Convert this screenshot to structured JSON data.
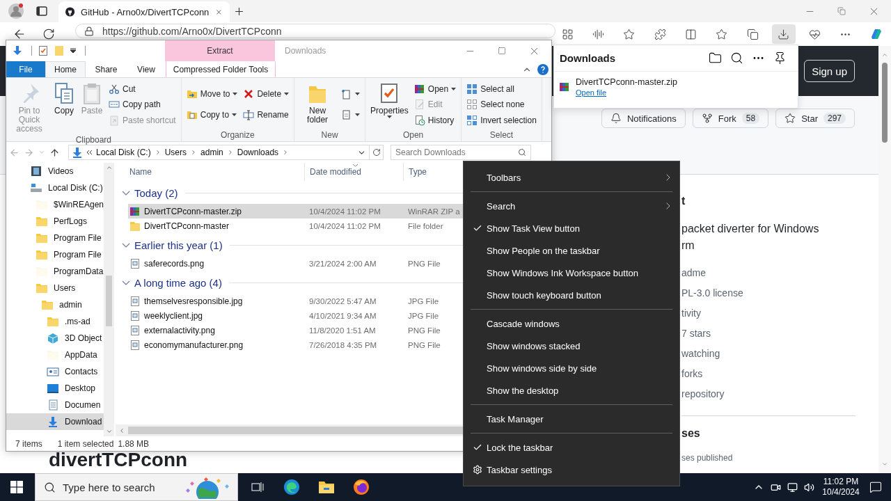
{
  "browser": {
    "tab": {
      "title": "GitHub - Arno0x/DivertTCPconn",
      "selected": true
    },
    "address": "https://github.com/Arno0x/DivertTCPconn",
    "page": {
      "header_button": "Sign up",
      "repo_actions": [
        {
          "label": "Notifications"
        },
        {
          "label": "Fork",
          "count": "58"
        },
        {
          "label": "Star",
          "count": "297"
        }
      ],
      "repo_title": "divertTCPconn",
      "about": {
        "heading": "t",
        "description": [
          "packet diverter for Windows",
          "rm"
        ],
        "links": [
          "adme",
          "PL-3.0 license",
          "tivity",
          "7 stars",
          "watching",
          "forks",
          "repository"
        ],
        "releases_heading": "ses",
        "releases_note": "ses published"
      }
    }
  },
  "downloads_panel": {
    "title": "Downloads",
    "items": [
      {
        "name": "DivertTCPconn-master.zip",
        "action": "Open file"
      }
    ]
  },
  "explorer": {
    "title": "Downloads",
    "contextual_group": "Extract",
    "tabs": [
      {
        "label": "File",
        "kind": "file",
        "selected": false
      },
      {
        "label": "Home",
        "kind": "tab",
        "selected": true
      },
      {
        "label": "Share",
        "kind": "tab",
        "selected": false
      },
      {
        "label": "View",
        "kind": "tab",
        "selected": false
      },
      {
        "label": "Compressed Folder Tools",
        "kind": "contextual",
        "selected": false
      }
    ],
    "ribbon": [
      {
        "label": "Clipboard",
        "columns": [
          {
            "kind": "large",
            "items": [
              {
                "label": "Pin to Quick access",
                "disabled": true,
                "dropdown": false
              }
            ]
          },
          {
            "kind": "large",
            "items": [
              {
                "label": "Copy",
                "disabled": false,
                "dropdown": false
              }
            ]
          },
          {
            "kind": "large",
            "items": [
              {
                "label": "Paste",
                "disabled": true,
                "dropdown": false
              }
            ]
          },
          {
            "kind": "stack",
            "items": [
              {
                "label": "Cut",
                "disabled": false,
                "dropdown": false
              },
              {
                "label": "Copy path",
                "disabled": false,
                "dropdown": false
              },
              {
                "label": "Paste shortcut",
                "disabled": true,
                "dropdown": false
              }
            ]
          }
        ]
      },
      {
        "label": "Organize",
        "columns": [
          {
            "kind": "stack",
            "items": [
              {
                "label": "Move to",
                "disabled": false,
                "dropdown": true
              },
              {
                "label": "Copy to",
                "disabled": false,
                "dropdown": true
              }
            ]
          },
          {
            "kind": "stack",
            "items": [
              {
                "label": "Delete",
                "disabled": false,
                "dropdown": true
              },
              {
                "label": "Rename",
                "disabled": false,
                "dropdown": false
              }
            ]
          }
        ]
      },
      {
        "label": "New",
        "columns": [
          {
            "kind": "large",
            "items": [
              {
                "label": "New folder",
                "disabled": false,
                "dropdown": false
              }
            ]
          },
          {
            "kind": "stack",
            "items": [
              {
                "disabled": false,
                "dropdown": true
              },
              {
                "disabled": false,
                "dropdown": true
              }
            ]
          }
        ]
      },
      {
        "label": "Open",
        "columns": [
          {
            "kind": "large",
            "items": [
              {
                "label": "Properties",
                "disabled": false,
                "dropdown": true
              }
            ]
          },
          {
            "kind": "stack",
            "items": [
              {
                "label": "Open",
                "disabled": false,
                "dropdown": true
              },
              {
                "label": "Edit",
                "disabled": true,
                "dropdown": false
              },
              {
                "label": "History",
                "disabled": false,
                "dropdown": false
              }
            ]
          }
        ]
      },
      {
        "label": "Select",
        "columns": [
          {
            "kind": "stack",
            "items": [
              {
                "label": "Select all",
                "disabled": false,
                "dropdown": false
              },
              {
                "label": "Select none",
                "disabled": false,
                "dropdown": false
              },
              {
                "label": "Invert selection",
                "disabled": false,
                "dropdown": false
              }
            ]
          }
        ]
      }
    ],
    "breadcrumbs": [
      "Local Disk (C:)",
      "Users",
      "admin",
      "Downloads"
    ],
    "search_placeholder": "Search Downloads",
    "navigation": [
      {
        "label": "Videos",
        "selected": false,
        "hidden": false
      },
      {
        "label": "Local Disk (C:)",
        "selected": false,
        "hidden": false,
        "children": [
          {
            "label": "$WinREAgen",
            "selected": false,
            "hidden": true
          },
          {
            "label": "PerfLogs",
            "selected": false,
            "hidden": false
          },
          {
            "label": "Program File",
            "selected": false,
            "hidden": false
          },
          {
            "label": "Program File",
            "selected": false,
            "hidden": false
          },
          {
            "label": "ProgramData",
            "selected": false,
            "hidden": true
          },
          {
            "label": "Users",
            "selected": false,
            "hidden": false,
            "children": [
              {
                "label": "admin",
                "selected": false,
                "hidden": false,
                "children": [
                  {
                    "label": ".ms-ad",
                    "selected": false,
                    "hidden": false
                  },
                  {
                    "label": "3D Object",
                    "selected": false,
                    "hidden": false
                  },
                  {
                    "label": "AppData",
                    "selected": false,
                    "hidden": true
                  },
                  {
                    "label": "Contacts",
                    "selected": false,
                    "hidden": false
                  },
                  {
                    "label": "Desktop",
                    "selected": false,
                    "hidden": false
                  },
                  {
                    "label": "Documen",
                    "selected": false,
                    "hidden": false
                  },
                  {
                    "label": "Download",
                    "selected": true,
                    "hidden": false
                  }
                ]
              }
            ]
          }
        ]
      }
    ],
    "columns": [
      "Name",
      "Date modified",
      "Type"
    ],
    "groups": [
      {
        "label": "Today (2)",
        "expanded": true,
        "files": [
          {
            "name": "DivertTCPconn-master.zip",
            "date": "10/4/2024 11:02 PM",
            "type": "WinRAR ZIP a",
            "selected": true
          },
          {
            "name": "DivertTCPconn-master",
            "date": "10/4/2024 11:02 PM",
            "type": "File folder",
            "selected": false
          }
        ]
      },
      {
        "label": "Earlier this year (1)",
        "expanded": true,
        "files": [
          {
            "name": "saferecords.png",
            "date": "3/21/2024 2:00 AM",
            "type": "PNG File",
            "selected": false
          }
        ]
      },
      {
        "label": "A long time ago (4)",
        "expanded": true,
        "files": [
          {
            "name": "themselvesresponsible.jpg",
            "date": "9/30/2022 5:47 AM",
            "type": "JPG File",
            "selected": false
          },
          {
            "name": "weeklyclient.jpg",
            "date": "4/10/2021 9:34 AM",
            "type": "JPG File",
            "selected": false
          },
          {
            "name": "externalactivity.png",
            "date": "11/8/2020 1:51 AM",
            "type": "PNG File",
            "selected": false
          },
          {
            "name": "economymanufacturer.png",
            "date": "7/26/2018 4:35 PM",
            "type": "PNG File",
            "selected": false
          }
        ]
      }
    ],
    "status": {
      "count": "7 items",
      "selection": "1 item selected",
      "size": "1.88 MB"
    }
  },
  "context_menu": {
    "items": [
      {
        "kind": "submenu",
        "label": "Toolbars"
      },
      {
        "kind": "separator"
      },
      {
        "kind": "submenu",
        "label": "Search"
      },
      {
        "kind": "toggle",
        "label": "Show Task View button",
        "checked": true
      },
      {
        "kind": "toggle",
        "label": "Show People on the taskbar",
        "checked": false
      },
      {
        "kind": "toggle",
        "label": "Show Windows Ink Workspace button",
        "checked": false
      },
      {
        "kind": "toggle",
        "label": "Show touch keyboard button",
        "checked": false
      },
      {
        "kind": "separator"
      },
      {
        "kind": "action",
        "label": "Cascade windows"
      },
      {
        "kind": "action",
        "label": "Show windows stacked"
      },
      {
        "kind": "action",
        "label": "Show windows side by side"
      },
      {
        "kind": "action",
        "label": "Show the desktop"
      },
      {
        "kind": "separator"
      },
      {
        "kind": "action",
        "label": "Task Manager"
      },
      {
        "kind": "separator"
      },
      {
        "kind": "toggle",
        "label": "Lock the taskbar",
        "checked": true
      },
      {
        "kind": "settings",
        "label": "Taskbar settings"
      }
    ]
  },
  "taskbar": {
    "search_placeholder": "Type here to search",
    "time": "11:02 PM",
    "date": "10/4/2024"
  }
}
